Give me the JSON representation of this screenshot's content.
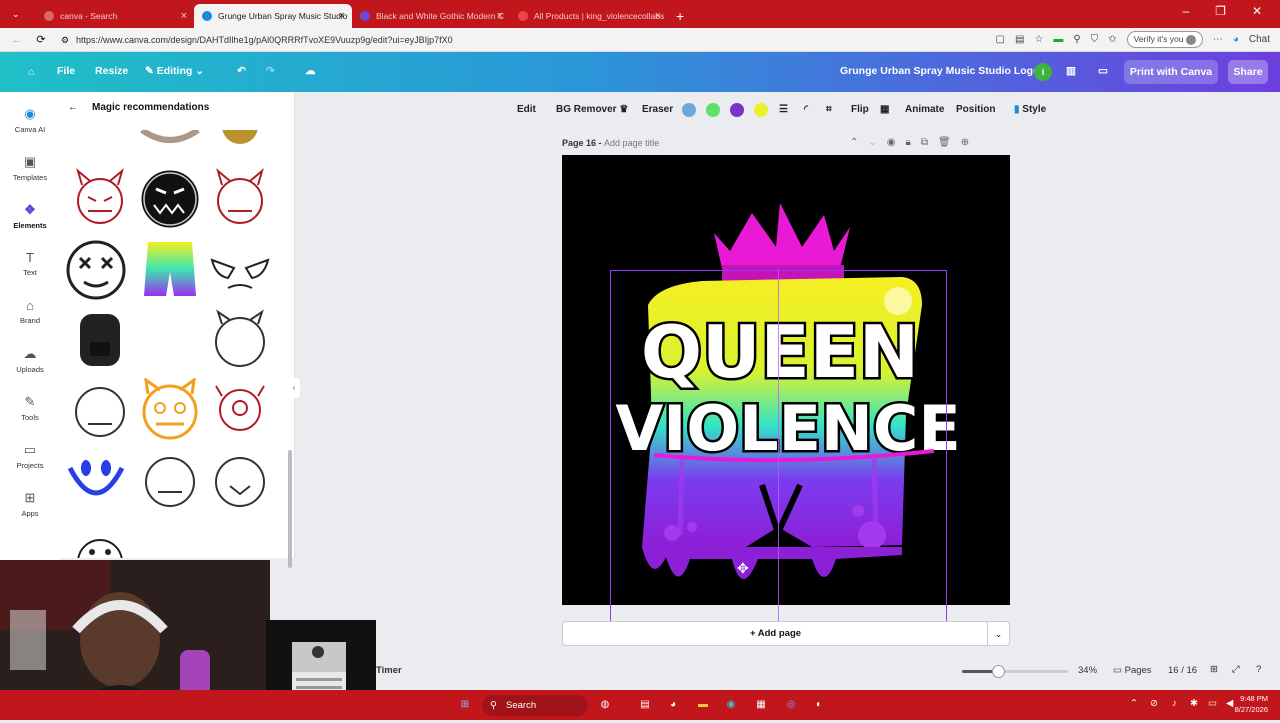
{
  "browser": {
    "tabs": [
      {
        "title": "canva - Search",
        "active": false
      },
      {
        "title": "Grunge Urban Spray Music Studio",
        "active": true
      },
      {
        "title": "Black and White Gothic Modern C",
        "active": false
      },
      {
        "title": "All Products | king_violencecollabs",
        "active": false
      }
    ],
    "url": "https://www.canva.com/design/DAHTdIlhe1g/pAl0QRRRfTvoXE9Vuuzp9g/edit?ui=eyJBIjp7fX0",
    "verify_label": "Verify it's you",
    "chat_label": "Chat"
  },
  "editor_header": {
    "file_label": "File",
    "resize_label": "Resize",
    "editing_label": "Editing",
    "design_title": "Grunge Urban Spray Music Studio Logo",
    "print_label": "Print with Canva",
    "share_label": "Share"
  },
  "rail": [
    {
      "label": "Canva AI",
      "icon": "canva-ai-icon"
    },
    {
      "label": "Templates",
      "icon": "templates-icon"
    },
    {
      "label": "Elements",
      "icon": "elements-icon"
    },
    {
      "label": "Text",
      "icon": "text-icon"
    },
    {
      "label": "Brand",
      "icon": "brand-icon"
    },
    {
      "label": "Uploads",
      "icon": "uploads-icon"
    },
    {
      "label": "Tools",
      "icon": "tools-icon"
    },
    {
      "label": "Projects",
      "icon": "projects-icon"
    },
    {
      "label": "Apps",
      "icon": "apps-icon"
    }
  ],
  "panel": {
    "title": "Magic recommendations"
  },
  "context_toolbar": {
    "edit_label": "Edit",
    "bg_remover_label": "BG Remover",
    "eraser_label": "Eraser",
    "flip_label": "Flip",
    "animate_label": "Animate",
    "position_label": "Position",
    "style_label": "Style",
    "colors": [
      "#6ea8d8",
      "#5fe06a",
      "#7a32c8",
      "#e8f226"
    ]
  },
  "page": {
    "page_label": "Page 16 -",
    "page_title_placeholder": "Add page title",
    "add_page_label": "+ Add page"
  },
  "artwork": {
    "line1": "QUEEN",
    "line2": "VIOLENCE"
  },
  "footer": {
    "timer_label": "Timer",
    "zoom_value": "34%",
    "zoom_level": 0.34,
    "pages_label": "Pages",
    "page_count": "16 / 16"
  },
  "taskbar": {
    "search_label": "Search",
    "time": "9:48 PM",
    "date": "8/27/2026"
  }
}
